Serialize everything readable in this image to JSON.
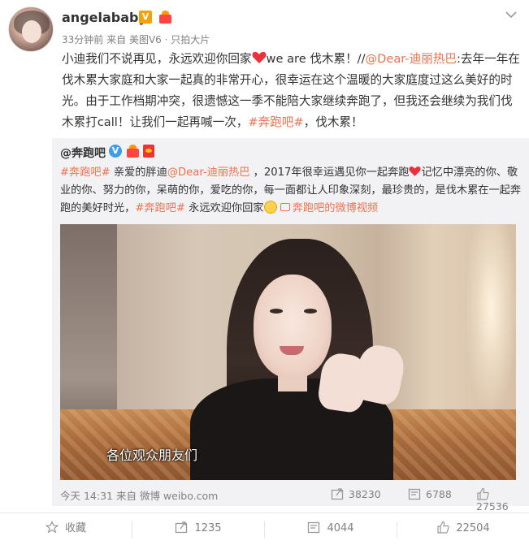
{
  "post": {
    "username": "angelababy",
    "badge_v": "V",
    "meta_time": "33分钟前",
    "meta_from": "来自",
    "meta_source": "美图V6 · 只拍大片",
    "text_1": "小迪我们不说再见，永远欢迎你回家",
    "text_2": "we are 伐木累！//",
    "mention": "@Dear-迪丽热巴",
    "text_3": ":去年一年在伐木累大家庭和大家一起真的非常开心，很幸运在这个温暖的大家庭度过这么美好的时光。由于工作档期冲突，很遗憾这一季不能陪大家继续奔跑了，但我还会继续为我们伐木累打call！让我们一起再喊一次，",
    "hashtag": "#奔跑吧#",
    "text_4": "，伐木累！"
  },
  "repost": {
    "username": "@奔跑吧",
    "hashtag_1": "#奔跑吧#",
    "text_1": " 亲爱的胖迪",
    "mention": "@Dear-迪丽热巴",
    "text_2": " ，2017年很幸运遇见你一起奔跑",
    "text_3": "记忆中漂亮的你、敬业的你、努力的你，呆萌的你，爱吃的你，每一面都让人印象深刻，最珍贵的，是伐木累在一起奔跑的美好时光，",
    "hashtag_2": "#奔跑吧#",
    "text_4": " 永远欢迎你回家",
    "video_link": "奔跑吧的微博视频",
    "video_subtitle": "各位观众朋友们",
    "time": "今天 14:31 来自 微博 weibo.com",
    "reposts": "38230",
    "comments": "6788",
    "likes": "27536"
  },
  "actions": {
    "favorite": "收藏",
    "repost": "1235",
    "comment": "4044",
    "like": "22504"
  },
  "colors": {
    "link": "#eb7350",
    "repost_bg": "#f2f2f5",
    "muted": "#808080"
  }
}
